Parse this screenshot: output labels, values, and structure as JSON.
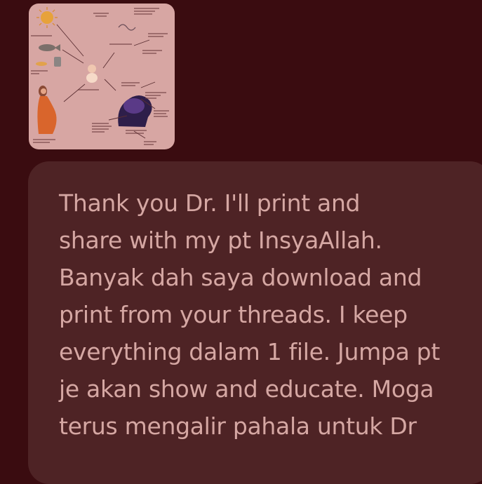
{
  "attachment": {
    "alt_icon": "infographic-thumbnail-icon"
  },
  "message": {
    "lines": [
      "Thank you Dr. I'll print and",
      "share with my pt InsyaAllah.",
      "Banyak dah saya download and",
      "print from your threads. I keep",
      "everything dalam 1 file. Jumpa pt",
      "je akan show and educate. Moga",
      "terus mengalir pahala untuk Dr"
    ]
  },
  "colors": {
    "background": "#3a0c10",
    "bubble": "#4e2325",
    "text": "#d5a7a3",
    "thumbnail": "#d7a6a3"
  }
}
